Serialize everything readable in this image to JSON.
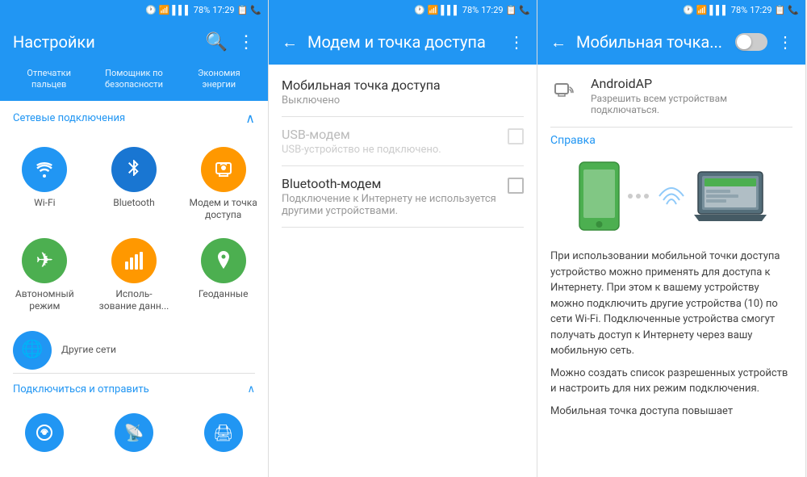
{
  "panel1": {
    "status": {
      "time": "17:29",
      "battery": "78%",
      "signal": "▌▌▌▌"
    },
    "header": {
      "title": "Настройки",
      "search_icon": "search",
      "menu_icon": "⋮"
    },
    "toolbar": [
      {
        "label": "Отпечатки\nпальцев"
      },
      {
        "label": "Помощник по\nбезопасности"
      },
      {
        "label": "Экономия\nэнергии"
      }
    ],
    "section1": {
      "label": "Сетевые подключения",
      "chevron": "∧"
    },
    "grid_items": [
      {
        "icon": "wifi",
        "label": "Wi-Fi",
        "color": "bg-blue",
        "unicode": "📶"
      },
      {
        "icon": "bluetooth",
        "label": "Bluetooth",
        "color": "bg-blue2",
        "unicode": "✦"
      },
      {
        "icon": "hotspot",
        "label": "Модем и точка доступа",
        "color": "bg-orange",
        "unicode": "📤"
      },
      {
        "icon": "airplane",
        "label": "Автономный режим",
        "color": "bg-green",
        "unicode": "✈"
      },
      {
        "icon": "data",
        "label": "Использование данн...",
        "color": "bg-orange",
        "unicode": "📊"
      },
      {
        "icon": "geo",
        "label": "Геоданные",
        "color": "bg-green",
        "unicode": "📍"
      }
    ],
    "other_networks": {
      "icon": "🌐",
      "label": "Другие сети",
      "color": "bg-blue3"
    },
    "section2": {
      "label": "Подключиться и отправить",
      "chevron": "∧"
    }
  },
  "panel2": {
    "status": {
      "time": "17:29",
      "battery": "78%"
    },
    "header": {
      "back_icon": "←",
      "title": "Модем и точка доступа",
      "menu_icon": "⋮"
    },
    "items": [
      {
        "title": "Мобильная точка доступа",
        "subtitle": "Выключено",
        "has_checkbox": false,
        "disabled": false,
        "standalone": true
      },
      {
        "title": "USB-модем",
        "subtitle": "USB-устройство не подключено.",
        "has_checkbox": true,
        "disabled": true,
        "standalone": false
      },
      {
        "title": "Bluetooth-модем",
        "subtitle": "Подключение к Интернету не используется другими устройствами.",
        "has_checkbox": true,
        "disabled": false,
        "standalone": false
      }
    ]
  },
  "panel3": {
    "status": {
      "time": "17:29",
      "battery": "78%"
    },
    "header": {
      "back_icon": "←",
      "title": "Мобильная точка...",
      "menu_icon": "⋮"
    },
    "toggle": {
      "on": false
    },
    "ap": {
      "icon": "📡",
      "name": "AndroidAP",
      "desc": "Разрешить всем устройствам подключаться."
    },
    "help_label": "Справка",
    "info_paragraphs": [
      "При использовании мобильной точки доступа устройство можно применять для доступа к Интернету. При этом к вашему устройству можно подключить другие устройства (10) по сети Wi-Fi. Подключенные устройства смогут получать доступ к Интернету через вашу мобильную сеть.",
      "Можно создать список разрешенных устройств и настроить для них режим подключения.",
      "Мобильная точка доступа повышает"
    ]
  }
}
